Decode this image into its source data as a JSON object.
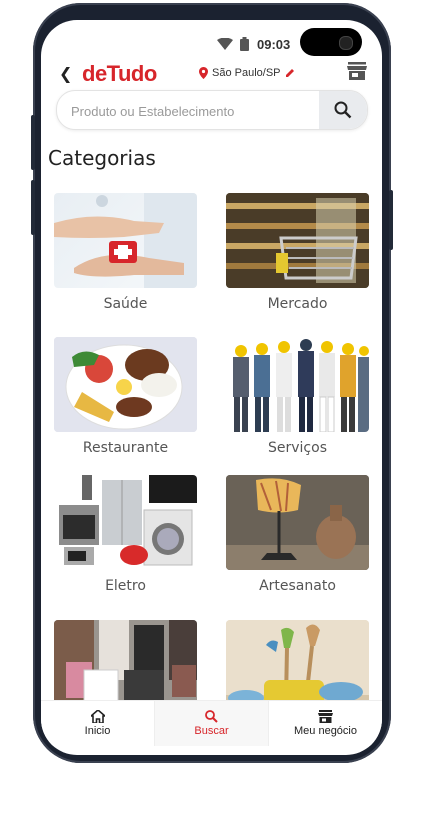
{
  "status": {
    "time": "09:03"
  },
  "header": {
    "logo": "deTudo",
    "location": "São Paulo/SP"
  },
  "search": {
    "placeholder": "Produto ou Estabelecimento"
  },
  "page_title": "Categorias",
  "categories": [
    {
      "label": "Saúde"
    },
    {
      "label": "Mercado"
    },
    {
      "label": "Restaurante"
    },
    {
      "label": "Serviços"
    },
    {
      "label": "Eletro"
    },
    {
      "label": "Artesanato"
    },
    {
      "label": ""
    },
    {
      "label": ""
    }
  ],
  "nav": [
    {
      "label": "Inicio",
      "icon": "home-icon"
    },
    {
      "label": "Buscar",
      "icon": "search-icon"
    },
    {
      "label": "Meu negócio",
      "icon": "store-icon"
    }
  ],
  "colors": {
    "brand": "#d7262b",
    "phone": "#1b2230"
  }
}
